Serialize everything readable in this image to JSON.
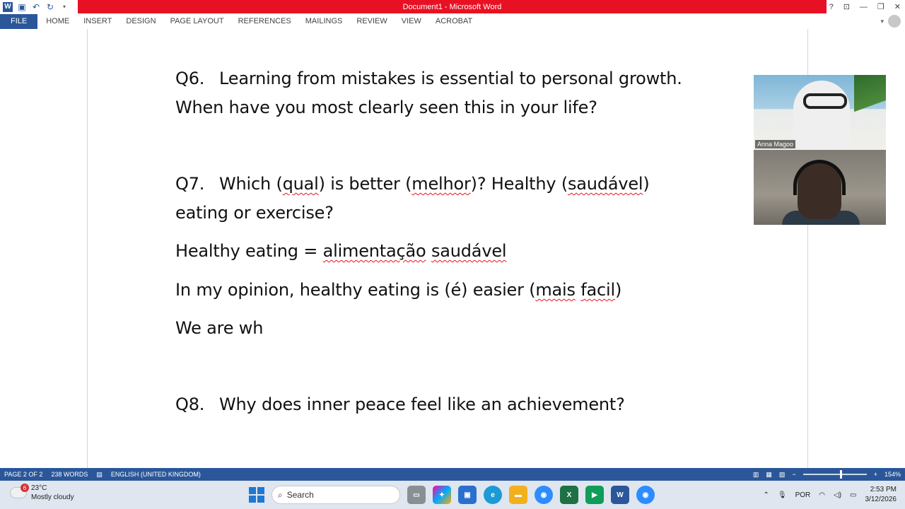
{
  "window": {
    "title": "Document1 - Microsoft Word",
    "title_bar_color": "#e81123"
  },
  "quick_access": {
    "icons": [
      "word-icon",
      "save-icon",
      "undo-icon",
      "redo-icon",
      "customize-icon"
    ]
  },
  "ribbon": {
    "tabs": [
      "FILE",
      "HOME",
      "INSERT",
      "DESIGN",
      "PAGE LAYOUT",
      "REFERENCES",
      "MAILINGS",
      "REVIEW",
      "VIEW",
      "ACROBAT"
    ],
    "accent": "#2b579a"
  },
  "document": {
    "q6_num": "Q6.",
    "q6_line1": "Learning from mistakes is essential to personal growth.",
    "q6_line2": "When have you most clearly seen this in your life?",
    "q7_num": "Q7.",
    "q7_a": "Which (",
    "q7_qual": "qual",
    "q7_b": ") is better (",
    "q7_melhor": "melhor",
    "q7_c": ")? Healthy (",
    "q7_saudavel": "saudável",
    "q7_d": ")",
    "q7_line2": "eating or exercise?",
    "he_a": "Healthy eating = ",
    "he_alimentacao": "alimentação",
    "he_space": " ",
    "he_saudavel": "saudável",
    "op_a": "In my opinion, healthy eating is (é) easier (",
    "op_mais": "mais",
    "op_space": " ",
    "op_facil": "facil",
    "op_b": ")",
    "we": "We are wh",
    "q8_num": "Q8.",
    "q8_line1": "Why does inner peace feel like an achievement?"
  },
  "video": {
    "participant1_name": "Anna Magoo"
  },
  "statusbar": {
    "page": "PAGE 2 OF 2",
    "words": "238 WORDS",
    "language": "ENGLISH (UNITED KINGDOM)",
    "zoom": "154%"
  },
  "taskbar": {
    "temp": "23°C",
    "weather": "Mostly cloudy",
    "weather_badge": "6",
    "search_placeholder": "Search",
    "language": "POR",
    "time": "2:53 PM",
    "date": "3/12/2026"
  }
}
